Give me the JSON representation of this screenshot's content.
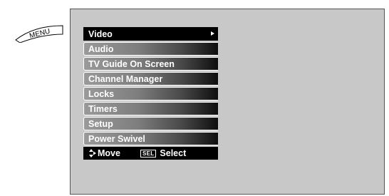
{
  "menu_tag": {
    "label": "MENU"
  },
  "menu": {
    "items": [
      {
        "label": "Video",
        "selected": true,
        "has_submenu_arrow": true
      },
      {
        "label": "Audio",
        "selected": false
      },
      {
        "label": "TV Guide On Screen",
        "selected": false
      },
      {
        "label": "Channel Manager",
        "selected": false
      },
      {
        "label": "Locks",
        "selected": false
      },
      {
        "label": "Timers",
        "selected": false
      },
      {
        "label": "Setup",
        "selected": false
      },
      {
        "label": "Power Swivel",
        "selected": false
      }
    ]
  },
  "help_bar": {
    "move_icon": "up-down-arrow-icon",
    "move_label": "Move",
    "sel_key_label": "SEL",
    "select_label": "Select"
  },
  "colors": {
    "screen_background": "#c8c8c8",
    "selected_item": "#000000",
    "item_text": "#ffffff"
  }
}
